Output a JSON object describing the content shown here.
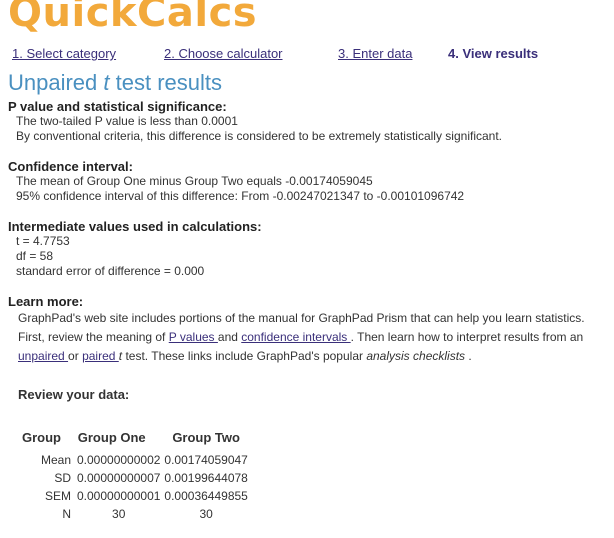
{
  "logo": "QuickCalcs",
  "steps": [
    {
      "label": "1. Select category"
    },
    {
      "label": "2. Choose calculator"
    },
    {
      "label": "3. Enter data"
    },
    {
      "label": "4. View results"
    }
  ],
  "title": {
    "prefix": "Unpaired ",
    "italic": "t",
    "suffix": " test results"
  },
  "pvalue": {
    "heading": "P value and statistical significance:",
    "lines": [
      "The two-tailed P value is less than 0.0001",
      "By conventional criteria, this difference is considered to be extremely statistically significant."
    ]
  },
  "ci": {
    "heading": "Confidence interval:",
    "lines": [
      "The mean of Group One minus Group Two equals -0.00174059045",
      "95% confidence interval of this difference: From -0.00247021347 to -0.00101096742"
    ]
  },
  "intermediate": {
    "heading": "Intermediate values used in calculations:",
    "lines": [
      "t = 4.7753",
      "df = 58",
      "standard error of difference = 0.000"
    ]
  },
  "learn": {
    "heading": "Learn more:",
    "t1": "GraphPad's web site includes portions of the manual for GraphPad Prism that can help you learn statistics. First, review the meaning of ",
    "link_pvalues": "P values ",
    "t2": "and ",
    "link_ci": "confidence intervals ",
    "t3": ". Then learn how to interpret results from an ",
    "link_unpaired": "unpaired ",
    "t4": "or ",
    "link_paired": "paired ",
    "paired_t": "t",
    "t5": " test. These links include GraphPad's popular ",
    "italic_checklists": "analysis checklists",
    "t6": " ."
  },
  "review": {
    "heading": "Review your data:",
    "columns": [
      "Group",
      "Group One",
      "Group Two"
    ],
    "rows": [
      {
        "label": "Mean",
        "one": "0.00000000002",
        "two": "0.00174059047"
      },
      {
        "label": "SD",
        "one": "0.00000000007",
        "two": "0.00199644078"
      },
      {
        "label": "SEM",
        "one": "0.00000000001",
        "two": "0.00036449855"
      },
      {
        "label": "N",
        "one": "30",
        "two": "30"
      }
    ]
  }
}
